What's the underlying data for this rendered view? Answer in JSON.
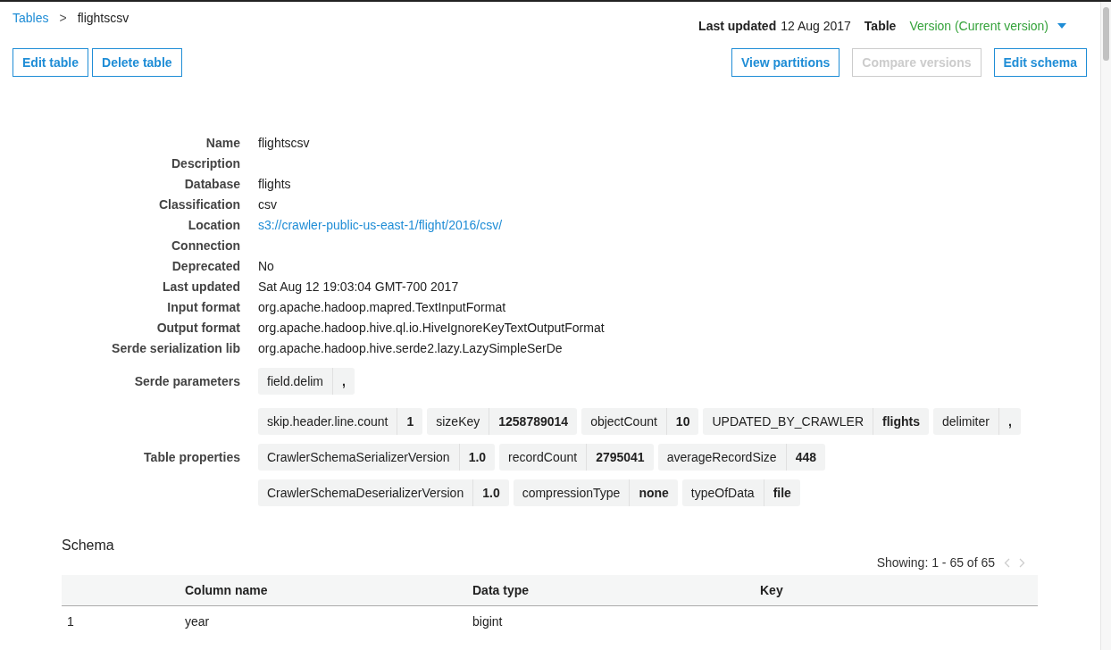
{
  "breadcrumb": {
    "parent": "Tables",
    "separator": ">",
    "current": "flightscsv"
  },
  "meta": {
    "last_updated_label": "Last updated",
    "last_updated_value": "12 Aug 2017",
    "table_label": "Table",
    "version": "Version (Current version)"
  },
  "left_buttons": [
    {
      "label": "Edit table",
      "disabled": false
    },
    {
      "label": "Delete table",
      "disabled": false
    }
  ],
  "right_buttons": [
    {
      "label": "View partitions",
      "disabled": false
    },
    {
      "label": "Compare versions",
      "disabled": true
    },
    {
      "label": "Edit schema",
      "disabled": false
    }
  ],
  "details": [
    {
      "label": "Name",
      "value": "flightscsv",
      "kind": "text"
    },
    {
      "label": "Description",
      "kind": "text"
    },
    {
      "label": "Database",
      "value": "flights",
      "kind": "text"
    },
    {
      "label": "Classification",
      "value": "csv",
      "kind": "text"
    },
    {
      "label": "Location",
      "value": "s3://crawler-public-us-east-1/flight/2016/csv/",
      "kind": "link"
    },
    {
      "label": "Connection",
      "kind": "text"
    },
    {
      "label": "Deprecated",
      "value": "No",
      "kind": "text"
    },
    {
      "label": "Last updated",
      "value": "Sat Aug 12 19:03:04 GMT-700 2017",
      "kind": "text"
    },
    {
      "label": "Input format",
      "value": "org.apache.hadoop.mapred.TextInputFormat",
      "kind": "text"
    },
    {
      "label": "Output format",
      "value": "org.apache.hadoop.hive.ql.io.HiveIgnoreKeyTextOutputFormat",
      "kind": "text"
    },
    {
      "label": "Serde serialization lib",
      "value": "org.apache.hadoop.hive.serde2.lazy.LazySimpleSerDe",
      "kind": "text"
    }
  ],
  "serde_parameters": {
    "label": "Serde parameters",
    "rows": [
      [
        {
          "key": "field.delim",
          "value": ","
        }
      ]
    ]
  },
  "table_properties": {
    "label": "Table properties",
    "rows": [
      [
        {
          "key": "skip.header.line.count",
          "value": "1"
        },
        {
          "key": "sizeKey",
          "value": "1258789014"
        },
        {
          "key": "objectCount",
          "value": "10"
        },
        {
          "key": "UPDATED_BY_CRAWLER",
          "value": "flights"
        },
        {
          "key": "delimiter",
          "value": ","
        }
      ],
      [
        {
          "key": "CrawlerSchemaSerializerVersion",
          "value": "1.0"
        },
        {
          "key": "recordCount",
          "value": "2795041"
        },
        {
          "key": "averageRecordSize",
          "value": "448"
        }
      ],
      [
        {
          "key": "CrawlerSchemaDeserializerVersion",
          "value": "1.0"
        },
        {
          "key": "compressionType",
          "value": "none"
        },
        {
          "key": "typeOfData",
          "value": "file"
        }
      ]
    ]
  },
  "schema": {
    "title": "Schema",
    "showing": "Showing: 1 - 65 of 65",
    "columns": [
      "",
      "Column name",
      "Data type",
      "Key"
    ],
    "rows": [
      [
        "1",
        "year",
        "bigint",
        ""
      ]
    ]
  }
}
